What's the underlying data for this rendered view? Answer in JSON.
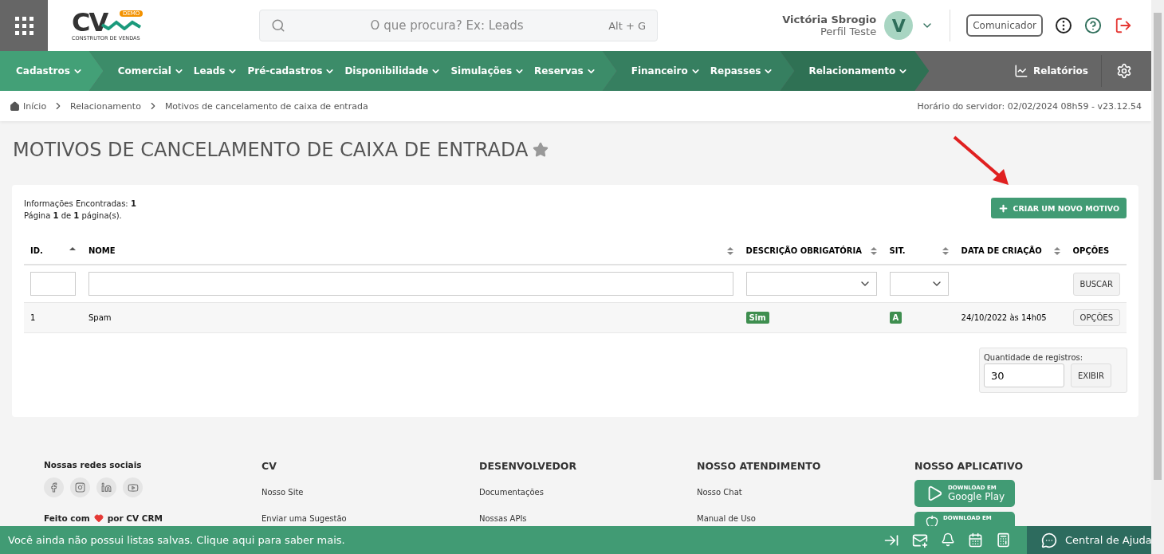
{
  "header": {
    "logo_badge": "DEMO",
    "logo_text": "CV",
    "logo_sub": "CONSTRUTOR DE VENDAS",
    "search": {
      "placeholder": "O que procura? Ex: Leads",
      "shortcut": "Alt + G"
    },
    "user": {
      "name": "Victória Sbrogio",
      "profile": "Perfil Teste",
      "initial": "V"
    },
    "communicator": "Comunicador"
  },
  "nav": {
    "groups": [
      {
        "color": "#43a077",
        "items": [
          {
            "label": "Cadastros"
          }
        ]
      },
      {
        "color": "#3c8c69",
        "items": [
          {
            "label": "Comercial"
          },
          {
            "label": "Leads"
          },
          {
            "label": "Pré-cadastros"
          },
          {
            "label": "Disponibilidade"
          },
          {
            "label": "Simulações"
          },
          {
            "label": "Reservas"
          }
        ]
      },
      {
        "color": "#367f60",
        "items": [
          {
            "label": "Financeiro"
          },
          {
            "label": "Repasses"
          }
        ]
      },
      {
        "color": "#2f7154",
        "items": [
          {
            "label": "Relacionamento"
          }
        ]
      }
    ],
    "reports": "Relatórios"
  },
  "breadcrumb": {
    "items": [
      "Início",
      "Relacionamento",
      "Motivos de cancelamento de caixa de entrada"
    ],
    "server_time": "Horário do servidor: 02/02/2024 08h59 - v23.12.54"
  },
  "page": {
    "title": "MOTIVOS DE CANCELAMENTO DE CAIXA DE ENTRADA",
    "favorite": false,
    "found": "Informações Encontradas: **1**",
    "pages": "Página **1** de **1** página(s).",
    "create_button": "CRIAR UM NOVO MOTIVO"
  },
  "table": {
    "columns": [
      {
        "label": "ID.",
        "sortable": true,
        "sorted": true,
        "filter": {
          "kind": "text"
        }
      },
      {
        "label": "NOME",
        "sortable": true,
        "sorted": false,
        "filter": {
          "kind": "text"
        }
      },
      {
        "label": "DESCRIÇÃO OBRIGATÓRIA",
        "sortable": true,
        "sorted": false,
        "filter": {
          "kind": "select"
        }
      },
      {
        "label": "SIT.",
        "sortable": true,
        "sorted": false,
        "filter": {
          "kind": "select"
        }
      },
      {
        "label": "DATA DE CRIAÇÃO",
        "sortable": true,
        "sorted": false
      },
      {
        "label": "OPÇÕES",
        "sortable": false,
        "filter": {
          "kind": "button",
          "label": "BUSCAR"
        }
      }
    ],
    "rows": [
      {
        "id": "1",
        "name": "Spam",
        "required": "Sim",
        "status": "A",
        "created": "24/10/2022 às 14h05",
        "options": "OPÇÕES"
      }
    ]
  },
  "records": {
    "label": "Quantidade de registros:",
    "value": "30",
    "button": "EXIBIR"
  },
  "footer": {
    "social_title": "Nossas redes sociais",
    "made_with": "Feito com",
    "made_by": "por CV CRM",
    "columns": [
      {
        "title": "CV",
        "links": [
          "Nosso Site",
          "Enviar uma Sugestão"
        ]
      },
      {
        "title": "DESENVOLVEDOR",
        "links": [
          "Documentações",
          "Nossas APIs"
        ]
      },
      {
        "title": "NOSSO ATENDIMENTO",
        "links": [
          "Nosso Chat",
          "Manual de Uso"
        ]
      }
    ],
    "app_title": "NOSSO APLICATIVO",
    "stores": [
      {
        "small": "DOWNLOAD EM",
        "big": "Google Play"
      },
      {
        "small": "DOWNLOAD EM"
      }
    ]
  },
  "bottom_bar": {
    "message": "Você ainda não possui listas salvas. Clique aqui para saber mais.",
    "help": "Central de Ajuda"
  }
}
